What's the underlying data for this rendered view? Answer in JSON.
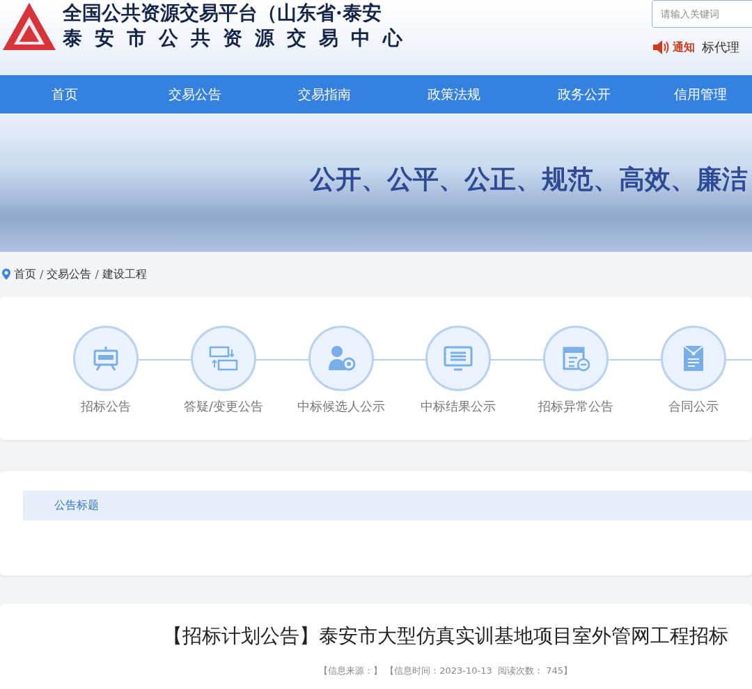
{
  "header": {
    "title_line1": "全国公共资源交易平台（山东省·泰安",
    "title_line2": "泰安市公共资源交易中心",
    "search": {
      "placeholder": "请输入关键词"
    },
    "notice": {
      "label": "通知",
      "text": "标代理"
    }
  },
  "nav": [
    {
      "label": "首页",
      "selected": false
    },
    {
      "label": "交易公告",
      "selected": false
    },
    {
      "label": "交易指南",
      "selected": false
    },
    {
      "label": "政策法规",
      "selected": false
    },
    {
      "label": "政务公开",
      "selected": false
    },
    {
      "label": "信用管理",
      "selected": false
    }
  ],
  "banner": {
    "slogan": "公开、公平、公正、规范、高效、廉洁"
  },
  "breadcrumb": [
    {
      "kind": "link",
      "text": "首页"
    },
    {
      "kind": "separator",
      "text": "/"
    },
    {
      "kind": "link",
      "text": "交易公告"
    },
    {
      "kind": "separator",
      "text": "/"
    },
    {
      "kind": "link",
      "text": "建设工程"
    }
  ],
  "categories": [
    {
      "label": "招标公告",
      "kind": "easel"
    },
    {
      "label": "答疑/变更公告",
      "kind": "exchange"
    },
    {
      "label": "中标候选人公示",
      "kind": "person"
    },
    {
      "label": "中标结果公示",
      "kind": "monitor"
    },
    {
      "label": "招标异常公告",
      "kind": "calendar"
    },
    {
      "label": "合同公示",
      "kind": "envelope"
    }
  ],
  "list": {
    "header": "公告标题"
  },
  "article": {
    "title": "【招标计划公告】泰安市大型仿真实训基地项目室外管网工程招标",
    "meta": "【信息来源：】 【信息时间：2023-10-13  阅读次数： 745】"
  }
}
